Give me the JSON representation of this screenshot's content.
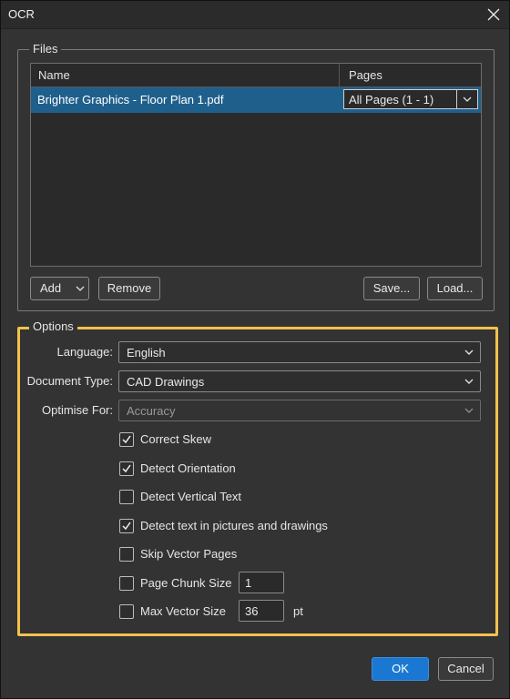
{
  "window": {
    "title": "OCR"
  },
  "files": {
    "group_label": "Files",
    "columns": {
      "name": "Name",
      "pages": "Pages"
    },
    "rows": [
      {
        "name": "Brighter Graphics - Floor Plan 1.pdf",
        "pages": "All Pages (1 - 1)"
      }
    ],
    "buttons": {
      "add": "Add",
      "remove": "Remove",
      "save": "Save...",
      "load": "Load..."
    }
  },
  "options": {
    "group_label": "Options",
    "language": {
      "label": "Language:",
      "value": "English"
    },
    "document_type": {
      "label": "Document Type:",
      "value": "CAD Drawings"
    },
    "optimise_for": {
      "label": "Optimise For:",
      "value": "Accuracy"
    },
    "checks": [
      {
        "label": "Correct Skew",
        "checked": true
      },
      {
        "label": "Detect Orientation",
        "checked": true
      },
      {
        "label": "Detect Vertical Text",
        "checked": false
      },
      {
        "label": "Detect text in pictures and drawings",
        "checked": true
      },
      {
        "label": "Skip Vector Pages",
        "checked": false
      },
      {
        "label": "Page Chunk Size",
        "checked": false
      },
      {
        "label": "Max Vector Size",
        "checked": false
      }
    ],
    "page_chunk_size": "1",
    "max_vector_size": "36",
    "max_vector_unit": "pt"
  },
  "footer": {
    "ok": "OK",
    "cancel": "Cancel"
  },
  "colors": {
    "accent": "#1a78d2",
    "selection": "#1f5f8c",
    "highlight": "#f2c14e"
  }
}
